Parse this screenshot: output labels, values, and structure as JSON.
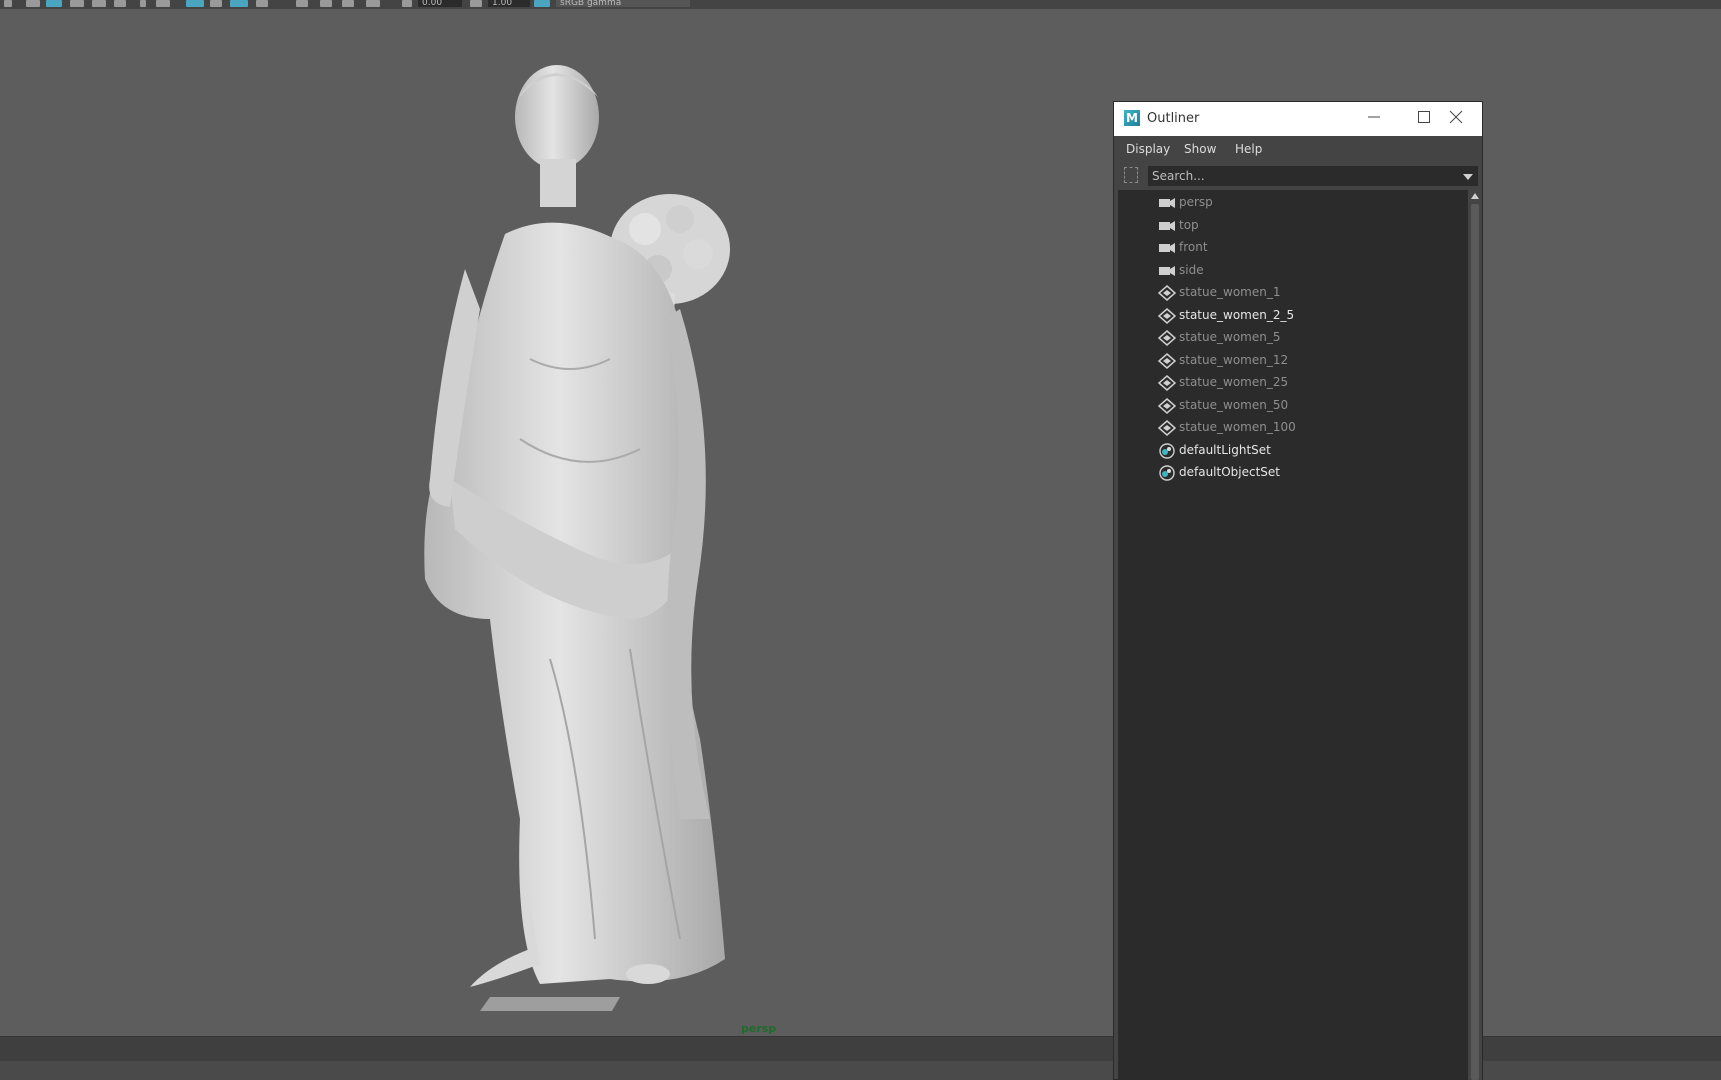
{
  "toolbar": {
    "field1": "0.00",
    "field2": "1.00",
    "colorspace": "sRGB gamma"
  },
  "viewport": {
    "camera_label": "persp"
  },
  "outliner": {
    "title": "Outliner",
    "menu": [
      "Display",
      "Show",
      "Help"
    ],
    "search": {
      "placeholder": "Search..."
    },
    "items": [
      {
        "label": "persp",
        "icon": "camera-icon",
        "dim": true
      },
      {
        "label": "top",
        "icon": "camera-icon",
        "dim": true
      },
      {
        "label": "front",
        "icon": "camera-icon",
        "dim": true
      },
      {
        "label": "side",
        "icon": "camera-icon",
        "dim": true
      },
      {
        "label": "statue_women_1",
        "icon": "mesh-transform-icon",
        "dim": true
      },
      {
        "label": "statue_women_2_5",
        "icon": "mesh-transform-icon",
        "dim": false
      },
      {
        "label": "statue_women_5",
        "icon": "mesh-transform-icon",
        "dim": true
      },
      {
        "label": "statue_women_12",
        "icon": "mesh-transform-icon",
        "dim": true
      },
      {
        "label": "statue_women_25",
        "icon": "mesh-transform-icon",
        "dim": true
      },
      {
        "label": "statue_women_50",
        "icon": "mesh-transform-icon",
        "dim": true
      },
      {
        "label": "statue_women_100",
        "icon": "mesh-transform-icon",
        "dim": true
      },
      {
        "label": "defaultLightSet",
        "icon": "set-icon",
        "dim": false
      },
      {
        "label": "defaultObjectSet",
        "icon": "set-icon",
        "dim": false
      }
    ]
  },
  "colors": {
    "viewport_bg": "#5d5d5d",
    "label_bright": "#e6e6e6",
    "label_dim": "#8e8e8e",
    "camera_label": "#1e6b2a",
    "accent": "#3fb4c4"
  }
}
